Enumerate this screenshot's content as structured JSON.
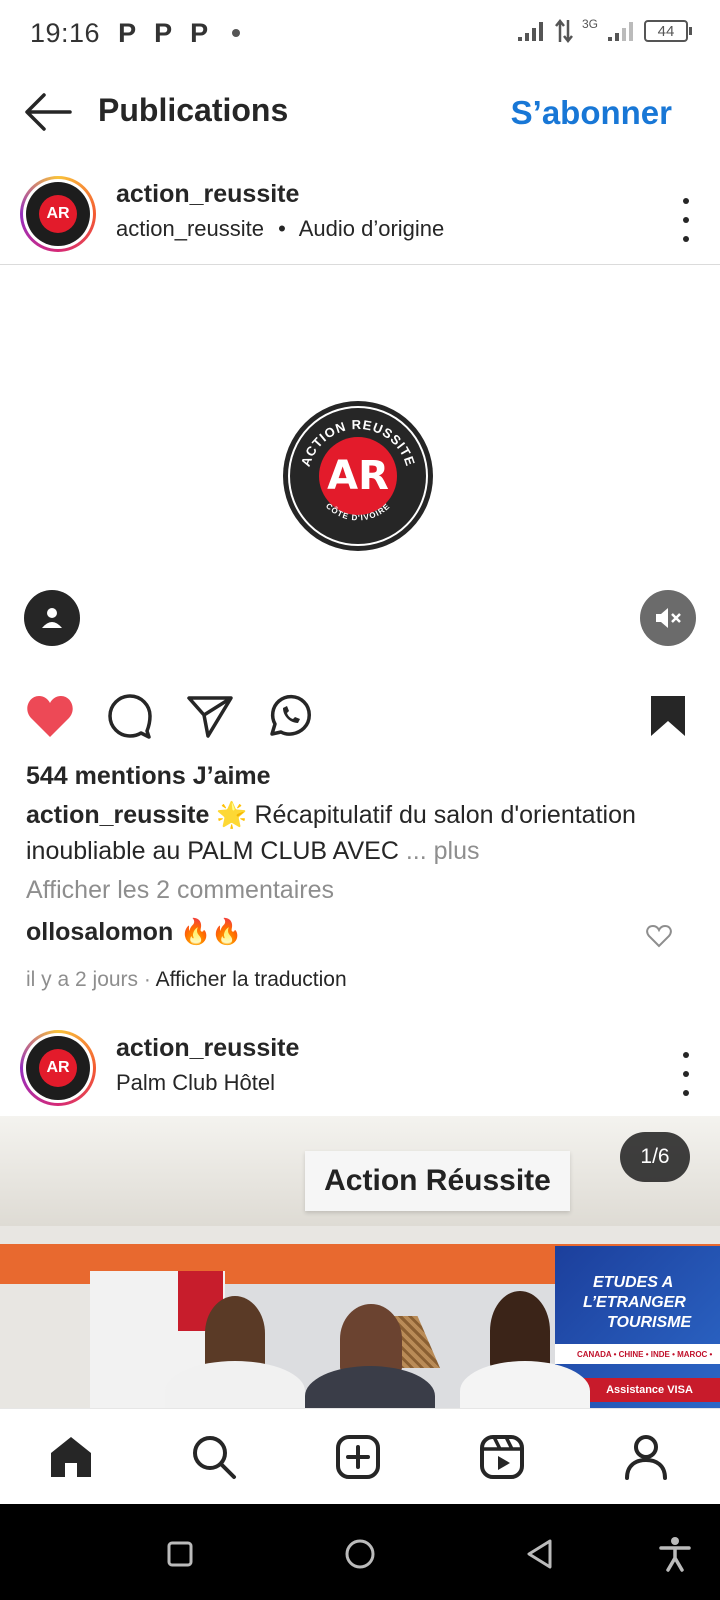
{
  "status_bar": {
    "time": "19:16",
    "notif_icons": [
      "P",
      "P",
      "P"
    ],
    "network": "3G",
    "battery": "44"
  },
  "header": {
    "title": "Publications",
    "subscribe_label": "S’abonner",
    "accent_color": "#1877d6"
  },
  "post1": {
    "username": "action_reussite",
    "audio_owner": "action_reussite",
    "separator": "•",
    "audio_label": "Audio d’origine",
    "logo_top_text": "ACTION REUSSITE",
    "logo_bottom_text": "CÔTE D'IVOIRE",
    "logo_initials": "AR",
    "likes": "544 mentions J’aime",
    "caption_user": "action_reussite",
    "caption_emoji": "🌟",
    "caption_text": "Récapitulatif du salon d'orientation inoubliable au PALM CLUB AVEC",
    "caption_more": "... plus",
    "view_comments": "Afficher les 2 commentaires",
    "comment_user": "ollosalomon",
    "comment_emoji": "🔥🔥",
    "comment_time": "il y a 2 jours",
    "comment_dot": "·",
    "translate_label": "Afficher la traduction",
    "liked": true,
    "saved": true,
    "like_color": "#ed4956"
  },
  "post2": {
    "username": "action_reussite",
    "location": "Palm Club Hôtel",
    "counter": "1/6",
    "sign_text": "Action Réussite",
    "banner_line1": "ETUDES A",
    "banner_line2": "L’ETRANGER",
    "banner_line3": "TOURISME",
    "banner_countries": "CANADA • CHINE • INDE • MAROC •",
    "banner_visa": "Assistance VISA"
  },
  "bottom_nav": [
    "home-icon",
    "search-icon",
    "create-icon",
    "reels-icon",
    "profile-icon"
  ],
  "system_nav": [
    "recents-icon",
    "home-circle-icon",
    "back-triangle-icon",
    "accessibility-icon"
  ]
}
